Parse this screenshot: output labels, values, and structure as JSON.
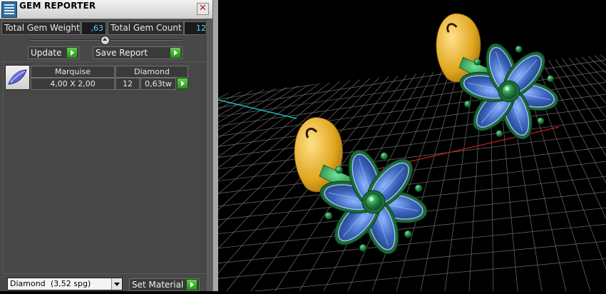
{
  "panel": {
    "title": "GEM REPORTER",
    "close_glyph": "✕",
    "total_weight_label": "Total Gem Weight",
    "total_weight_value": ",63",
    "total_count_label": "Total Gem Count",
    "total_count_value": "12",
    "update_label": "Update",
    "save_report_label": "Save Report"
  },
  "table": {
    "header_shape": "Marquise",
    "header_material": "Diamond",
    "size": "4,00 X 2,00",
    "count": "12",
    "weight": "0,63tw"
  },
  "material": {
    "selected_name": "Diamond",
    "selected_density": "(3,52 spg)",
    "set_material_label": "Set Material"
  },
  "viewport": {
    "grid_color": "#6e6e6e",
    "gold_color": "#e0a61e",
    "green_color": "#1f7d3c",
    "blue_color": "#4f78cf"
  }
}
